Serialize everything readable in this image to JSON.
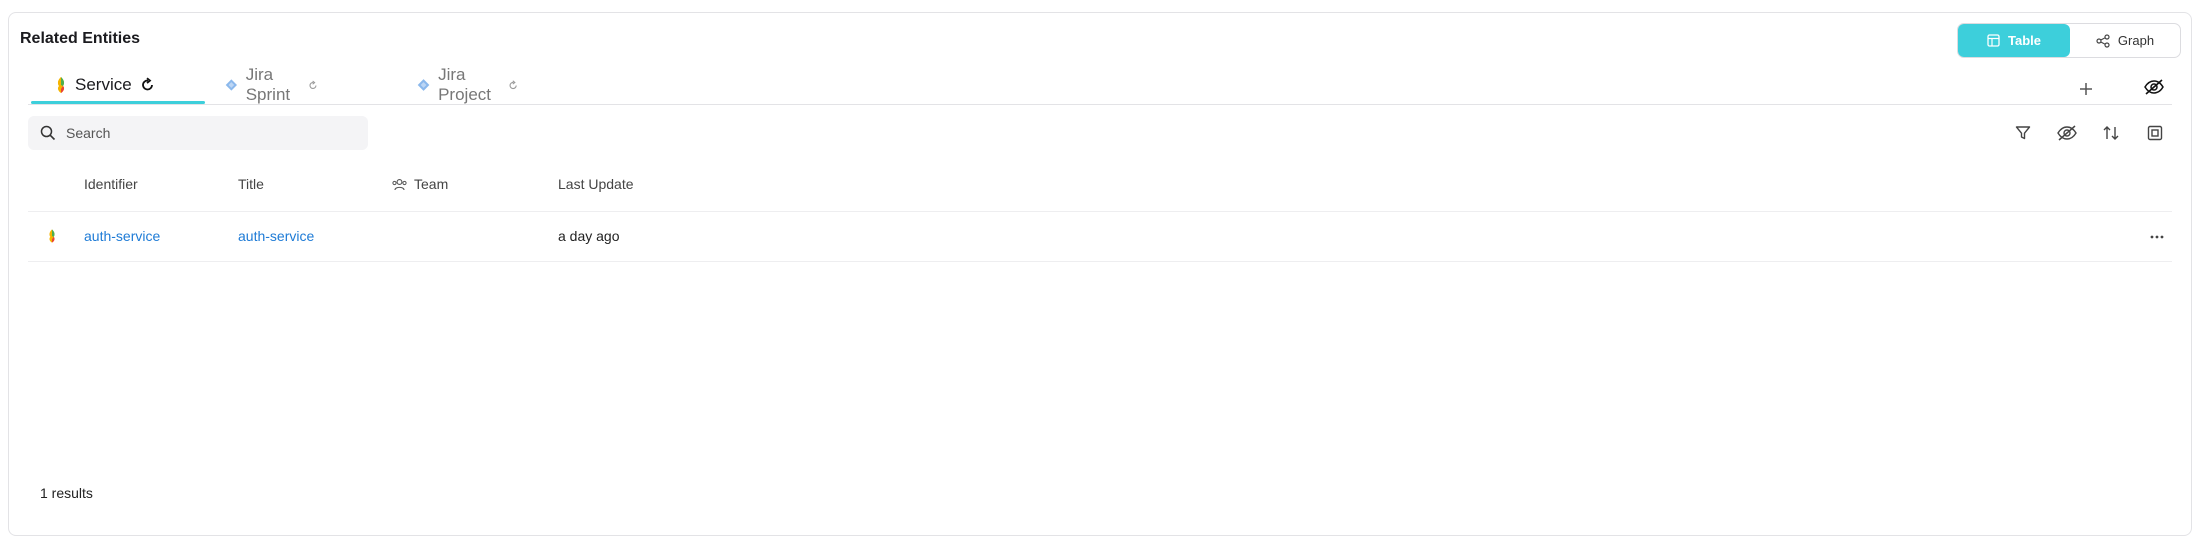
{
  "title": "Related Entities",
  "view_toggle": {
    "table_label": "Table",
    "graph_label": "Graph"
  },
  "tabs": [
    {
      "label": "Service",
      "icon": "service-icon",
      "active": true
    },
    {
      "label": "Jira Sprint",
      "icon": "jira-icon",
      "active": false
    },
    {
      "label": "Jira Project",
      "icon": "jira-icon",
      "active": false
    }
  ],
  "search": {
    "placeholder": "Search",
    "value": ""
  },
  "table": {
    "columns": [
      "Identifier",
      "Title",
      "Team",
      "Last Update"
    ],
    "rows": [
      {
        "icon": "service-icon",
        "identifier": "auth-service",
        "title": "auth-service",
        "team": "",
        "last_update": "a day ago"
      }
    ]
  },
  "footer": {
    "results": "1 results"
  },
  "colors": {
    "accent": "#3dcfdb",
    "link": "#1e7bd6",
    "jira": "#8bb8ec"
  }
}
